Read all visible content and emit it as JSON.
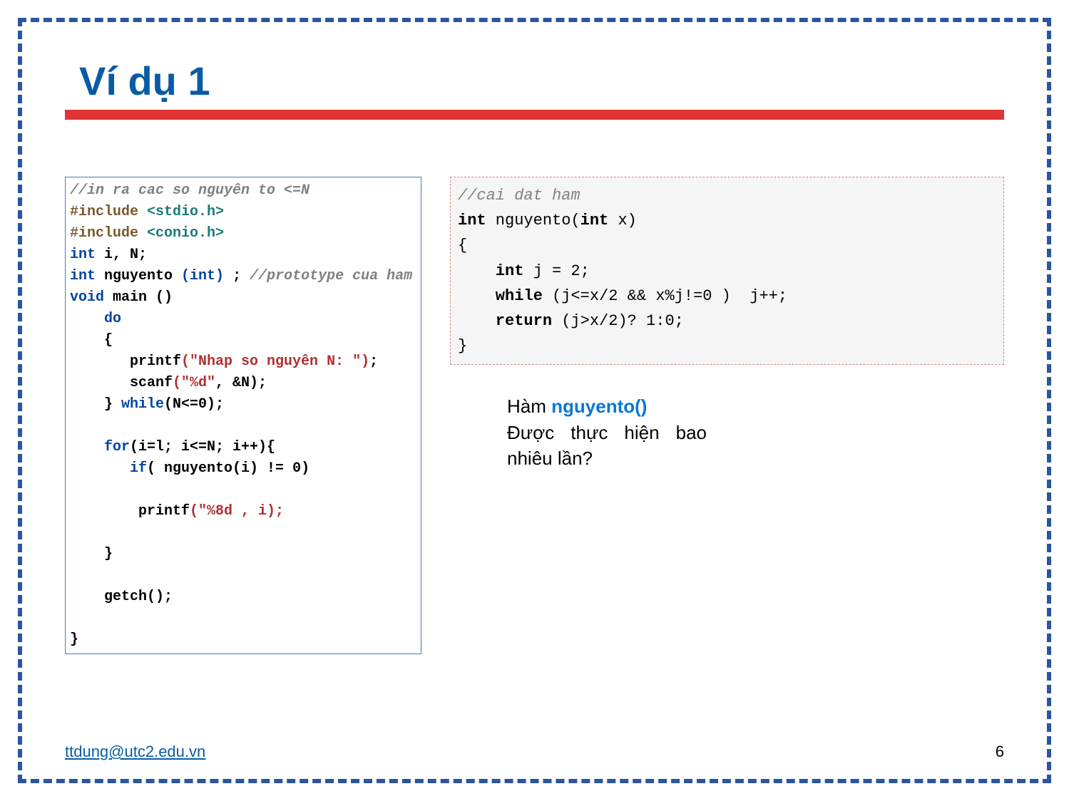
{
  "title": "Ví dụ 1",
  "footer": {
    "email": "ttdung@utc2.edu.vn",
    "page": "6"
  },
  "left_code": {
    "c1": "//in ra cac so nguyên to <=N",
    "l2a": "#include ",
    "l2b": "<stdio.h>",
    "l3a": "#include ",
    "l3b": "<conio.h>",
    "l4a": "int",
    "l4b": " i, N;",
    "l5a": "int",
    "l5b": " nguyento ",
    "l5c": "(int)",
    "l5d": " ; ",
    "l5e": "//prototype cua ham",
    "l6a": "void",
    "l6b": " main ()",
    "l7a": "    do",
    "l8": "    {",
    "l9a": "       printf",
    "l9b": "(\"Nhap so nguyên N: \")",
    "l9c": ";",
    "l10a": "       scanf",
    "l10b": "(\"%d\"",
    "l10c": ", &N);",
    "l11a": "    } ",
    "l11b": "while",
    "l11c": "(N<=0);",
    "l12a": "    for",
    "l12b": "(i=l; i<=N; i++){",
    "l13a": "       if",
    "l13b": "( nguyento(i) != 0)",
    "l14a": "        printf",
    "l14b": "(\"%8d , i);",
    "l15": "    }",
    "l16": "    getch();",
    "l17": "}"
  },
  "right_code": {
    "c1": "//cai dat ham",
    "l2a": "int",
    "l2b": " nguyento(",
    "l2c": "int",
    "l2d": " x)",
    "l3": "{",
    "l4a": "    int",
    "l4b": " j = 2;",
    "l5a": "    while",
    "l5b": " (j<=x/2 && x%j!=0 )  j++;",
    "l6a": "    return",
    "l6b": " (j>x/2)? 1:0;",
    "l7": "}"
  },
  "question": {
    "t1": "Hàm ",
    "fn": "nguyento()",
    "t2": "Được thực hiện bao nhiêu lần?"
  }
}
